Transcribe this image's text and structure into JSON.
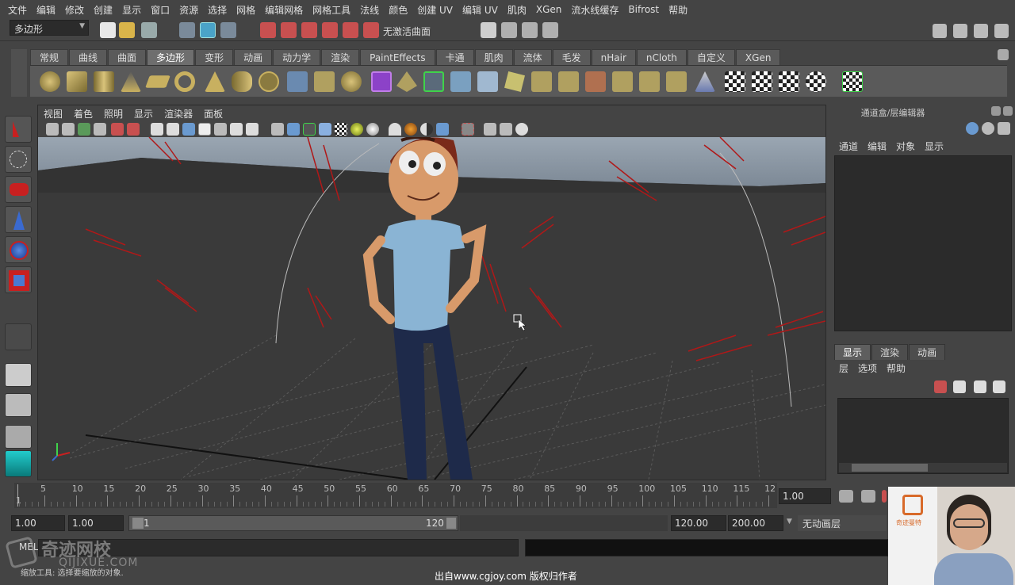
{
  "menu": [
    "文件",
    "编辑",
    "修改",
    "创建",
    "显示",
    "窗口",
    "资源",
    "选择",
    "网格",
    "编辑网格",
    "网格工具",
    "法线",
    "颜色",
    "创建 UV",
    "编辑 UV",
    "肌肉",
    "XGen",
    "流水线缓存",
    "Bifrost",
    "帮助"
  ],
  "statusline": {
    "mode_dropdown": "多边形",
    "live_surface": "无激活曲面"
  },
  "shelf_tabs": [
    "常规",
    "曲线",
    "曲面",
    "多边形",
    "变形",
    "动画",
    "动力学",
    "渲染",
    "PaintEffects",
    "卡通",
    "肌肉",
    "流体",
    "毛发",
    "nHair",
    "nCloth",
    "自定义",
    "XGen"
  ],
  "shelf_active": "多边形",
  "viewport": {
    "menu": [
      "视图",
      "着色",
      "照明",
      "显示",
      "渲染器",
      "面板"
    ]
  },
  "channel_box": {
    "title": "通道盒/层编辑器",
    "menu": [
      "通道",
      "编辑",
      "对象",
      "显示"
    ]
  },
  "layer_editor": {
    "tabs": [
      "显示",
      "渲染",
      "动画"
    ],
    "active_tab": "显示",
    "menu": [
      "层",
      "选项",
      "帮助"
    ]
  },
  "timeline": {
    "ticks": [
      "5",
      "10",
      "15",
      "20",
      "25",
      "30",
      "35",
      "40",
      "45",
      "50",
      "55",
      "60",
      "65",
      "70",
      "75",
      "80",
      "85",
      "90",
      "95",
      "100",
      "105",
      "110",
      "115",
      "12"
    ],
    "start_marker": "1",
    "current_frame": "1.00"
  },
  "range": {
    "start_time": "1.00",
    "playback_start": "1.00",
    "slider_start": "1",
    "slider_end": "120",
    "playback_end": "120.00",
    "end_time": "200.00",
    "anim_layer": "无动画层"
  },
  "command_line": {
    "label": "MEL"
  },
  "help_line": {
    "text": "缩放工具: 选择要缩放的对象."
  },
  "watermarks": {
    "logo_cn": "奇迹网校",
    "logo_en": "QIJIXUE.COM",
    "credit": "出自www.cgjoy.com 版权归作者"
  },
  "webcam": {
    "board_text": "奇迹曼特"
  },
  "colors": {
    "ui_bg": "#444444",
    "field_bg": "#2b2b2b",
    "accent_green": "#3fd34a",
    "selection_red": "#b01818"
  }
}
